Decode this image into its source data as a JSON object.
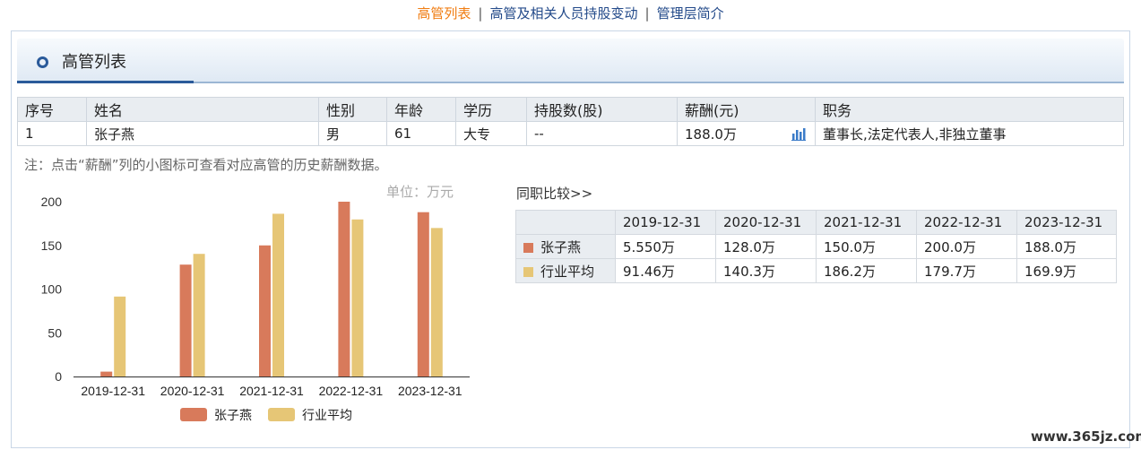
{
  "nav": {
    "items": [
      "高管列表",
      "高管及相关人员持股变动",
      "管理层简介"
    ],
    "separator": "|"
  },
  "section": {
    "title": "高管列表"
  },
  "managers": {
    "headers": [
      "序号",
      "姓名",
      "性别",
      "年龄",
      "学历",
      "持股数(股)",
      "薪酬(元)",
      "职务"
    ],
    "rows": [
      [
        "1",
        "张子燕",
        "男",
        "61",
        "大专",
        "--",
        "188.0万",
        "董事长,法定代表人,非独立董事"
      ]
    ]
  },
  "note": "注：点击“薪酬”列的小图标可查看对应高管的历史薪酬数据。",
  "chart_unit": "单位：万元",
  "compare": {
    "title": "同职比较>>",
    "headers": [
      "2019-12-31",
      "2020-12-31",
      "2021-12-31",
      "2022-12-31",
      "2023-12-31"
    ],
    "rows": [
      {
        "name": "张子燕",
        "color": "#d87a5b",
        "values": [
          "5.550万",
          "128.0万",
          "150.0万",
          "200.0万",
          "188.0万"
        ]
      },
      {
        "name": "行业平均",
        "color": "#e6c676",
        "values": [
          "91.46万",
          "140.3万",
          "186.2万",
          "179.7万",
          "169.9万"
        ]
      }
    ]
  },
  "chart_data": {
    "type": "bar",
    "categories": [
      "2019-12-31",
      "2020-12-31",
      "2021-12-31",
      "2022-12-31",
      "2023-12-31"
    ],
    "series": [
      {
        "name": "张子燕",
        "color": "#d87a5b",
        "values": [
          5.55,
          128.0,
          150.0,
          200.0,
          188.0
        ]
      },
      {
        "name": "行业平均",
        "color": "#e6c676",
        "values": [
          91.46,
          140.3,
          186.2,
          179.7,
          169.9
        ]
      }
    ],
    "ylim": [
      0,
      200
    ],
    "yticks": [
      0,
      50,
      100,
      150,
      200
    ],
    "legend": "bottom",
    "grid": false
  },
  "watermark": "www.365jz.com"
}
